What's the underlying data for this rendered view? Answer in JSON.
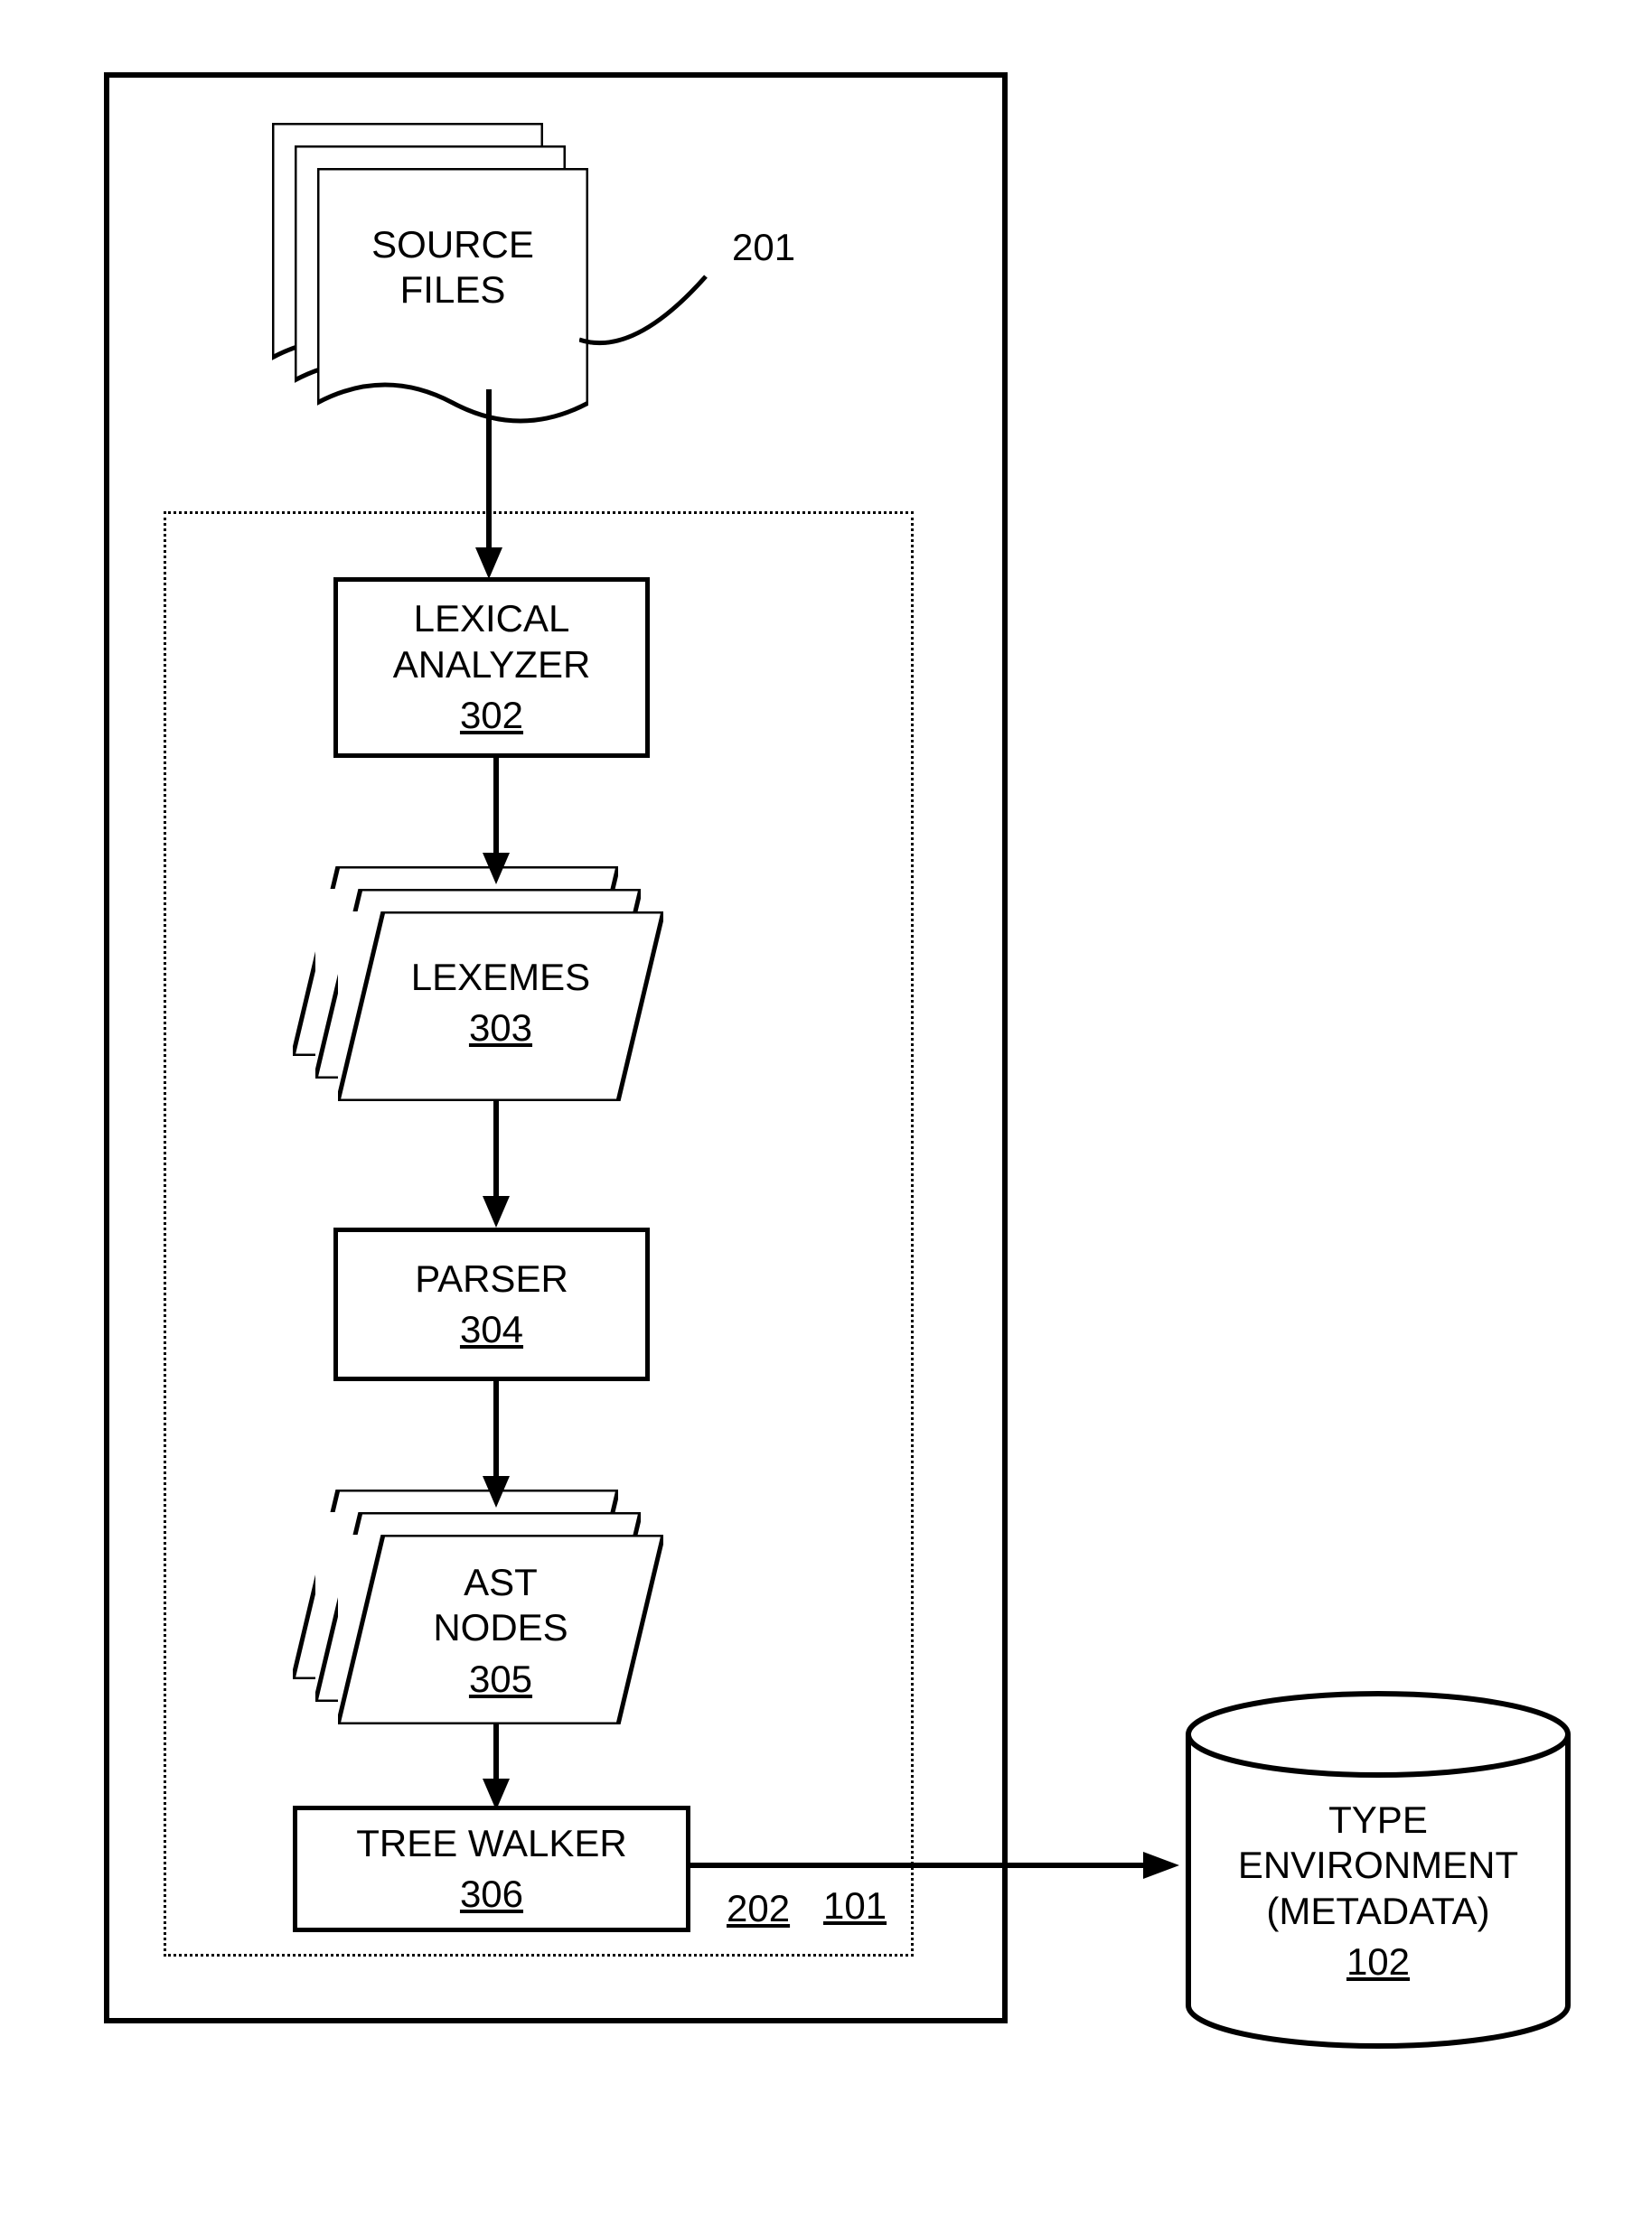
{
  "outer_ref": "101",
  "inner_ref": "202",
  "source_files": {
    "label_l1": "SOURCE",
    "label_l2": "FILES",
    "ref": "201"
  },
  "lexical": {
    "label_l1": "LEXICAL",
    "label_l2": "ANALYZER",
    "ref": "302"
  },
  "lexemes": {
    "label": "LEXEMES",
    "ref": "303"
  },
  "parser": {
    "label": "PARSER",
    "ref": "304"
  },
  "ast": {
    "label_l1": "AST",
    "label_l2": "NODES",
    "ref": "305"
  },
  "treewalker": {
    "label": "TREE WALKER",
    "ref": "306"
  },
  "typeenv": {
    "label_l1": "TYPE",
    "label_l2": "ENVIRONMENT",
    "label_l3": "(METADATA)",
    "ref": "102"
  }
}
